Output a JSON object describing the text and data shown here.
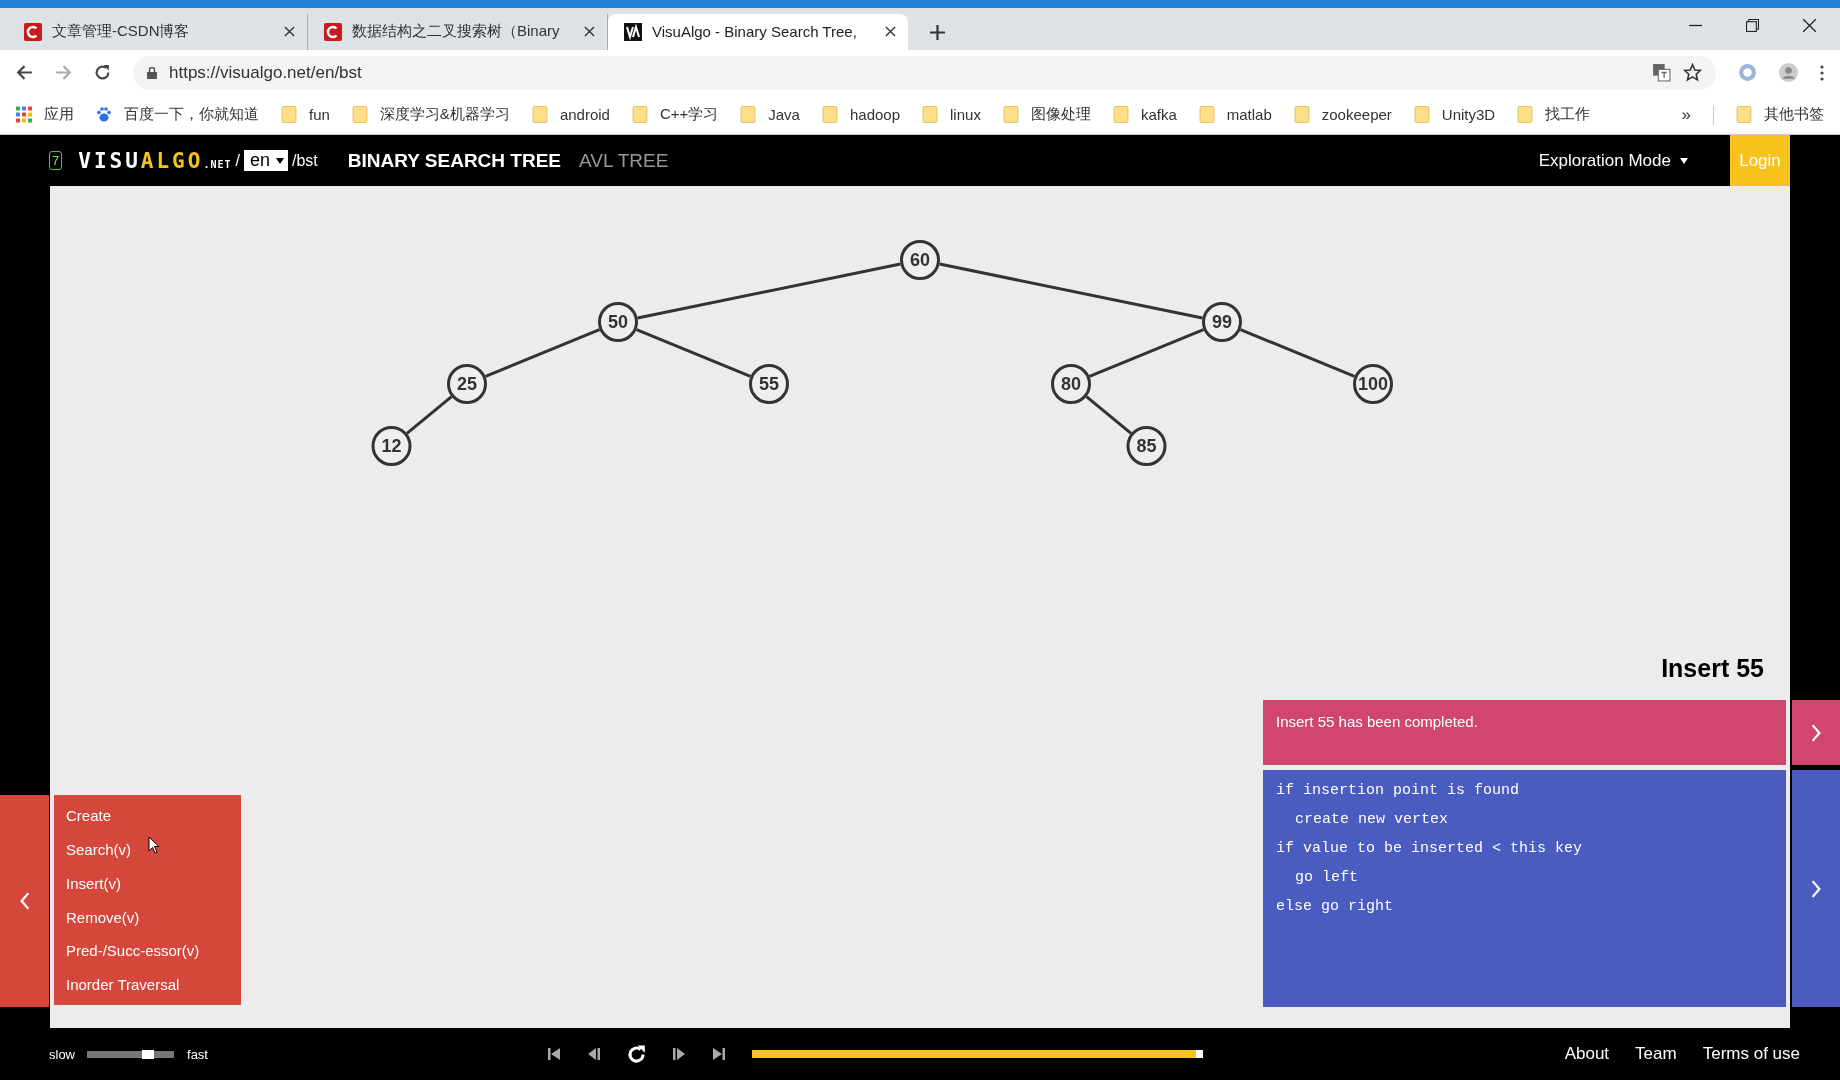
{
  "browser": {
    "tabs": [
      {
        "title": "文章管理-CSDN博客",
        "kind": "csdn",
        "selected": false
      },
      {
        "title": "数据结构之二叉搜索树（Binary",
        "kind": "csdn",
        "selected": false
      },
      {
        "title": "VisuAlgo - Binary Search Tree,",
        "kind": "visualgo",
        "selected": true
      }
    ],
    "address": "https://visualgo.net/en/bst",
    "bookmarks": [
      {
        "label": "应用",
        "kind": "apps"
      },
      {
        "label": "百度一下，你就知道",
        "kind": "baidu"
      },
      {
        "label": "fun",
        "kind": "folder"
      },
      {
        "label": "深度学习&机器学习",
        "kind": "folder"
      },
      {
        "label": "android",
        "kind": "folder"
      },
      {
        "label": "C++学习",
        "kind": "folder"
      },
      {
        "label": "Java",
        "kind": "folder"
      },
      {
        "label": "hadoop",
        "kind": "folder"
      },
      {
        "label": "linux",
        "kind": "folder"
      },
      {
        "label": "图像处理",
        "kind": "folder"
      },
      {
        "label": "kafka",
        "kind": "folder"
      },
      {
        "label": "matlab",
        "kind": "folder"
      },
      {
        "label": "zookeeper",
        "kind": "folder"
      },
      {
        "label": "Unity3D",
        "kind": "folder"
      },
      {
        "label": "找工作",
        "kind": "folder"
      }
    ],
    "overflow": "»",
    "other_bookmarks": "其他书签"
  },
  "header": {
    "badge": "7",
    "logo": [
      "VISU",
      "ALGO"
    ],
    "logo_suffix": ".NET",
    "separator": "/",
    "language": "en",
    "path": "/bst",
    "nav": [
      {
        "label": "BINARY SEARCH TREE",
        "selected": true
      },
      {
        "label": "AVL TREE",
        "selected": false
      }
    ],
    "mode": "Exploration Mode",
    "login": "Login"
  },
  "tree": {
    "value": "60",
    "children": [
      {
        "value": "50",
        "kind": "left",
        "children": [
          {
            "value": "25",
            "kind": "left",
            "children": [
              {
                "value": "12",
                "kind": "left"
              }
            ]
          },
          {
            "value": "55",
            "kind": "right"
          }
        ]
      },
      {
        "value": "99",
        "kind": "right",
        "children": [
          {
            "value": "80",
            "kind": "left",
            "children": [
              {
                "value": "85",
                "kind": "right"
              }
            ]
          },
          {
            "value": "100",
            "kind": "right"
          }
        ]
      }
    ]
  },
  "status": {
    "title": "Insert 55",
    "message": "Insert 55 has been completed.",
    "code": [
      {
        "text": "if insertion point is found",
        "indented": false
      },
      {
        "text": "create new vertex",
        "indented": true
      },
      {
        "text": "if value to be inserted < this key",
        "indented": false
      },
      {
        "text": "go left",
        "indented": true
      },
      {
        "text": "else go right",
        "indented": false
      }
    ]
  },
  "menu": [
    "Create",
    "Search(v)",
    "Insert(v)",
    "Remove(v)",
    "Pred-/Succ-essor(v)",
    "Inorder Traversal"
  ],
  "footer": {
    "slow": "slow",
    "fast": "fast",
    "speed": {
      "level": 0.7
    },
    "progress": {
      "level": 1
    },
    "links": [
      "About",
      "Team",
      "Terms of use"
    ]
  }
}
